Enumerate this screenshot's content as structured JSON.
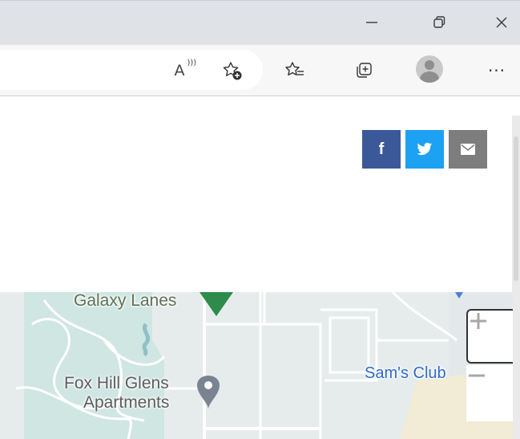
{
  "window": {
    "controls": [
      "minimize",
      "maximize",
      "close"
    ]
  },
  "toolbar": {
    "read_aloud_label": "A",
    "icons": [
      "read-aloud-icon",
      "add-favorite-icon",
      "favorites-icon",
      "collections-icon",
      "profile-avatar",
      "more-icon"
    ],
    "more_label": "···"
  },
  "share": {
    "facebook_label": "f",
    "twitter_icon": "twitter-bird-icon",
    "email_icon": "envelope-icon",
    "colors": {
      "facebook": "#3b5998",
      "twitter": "#1da1f2",
      "email": "#7d7d7d"
    }
  },
  "map": {
    "labels": {
      "galaxy_lanes": "Galaxy Lanes",
      "fox_hill_line1": "Fox Hill Glens",
      "fox_hill_line2": "Apartments",
      "sams_club": "Sam's Club"
    },
    "zoom_in_label": "+",
    "zoom_out_label": "−"
  }
}
